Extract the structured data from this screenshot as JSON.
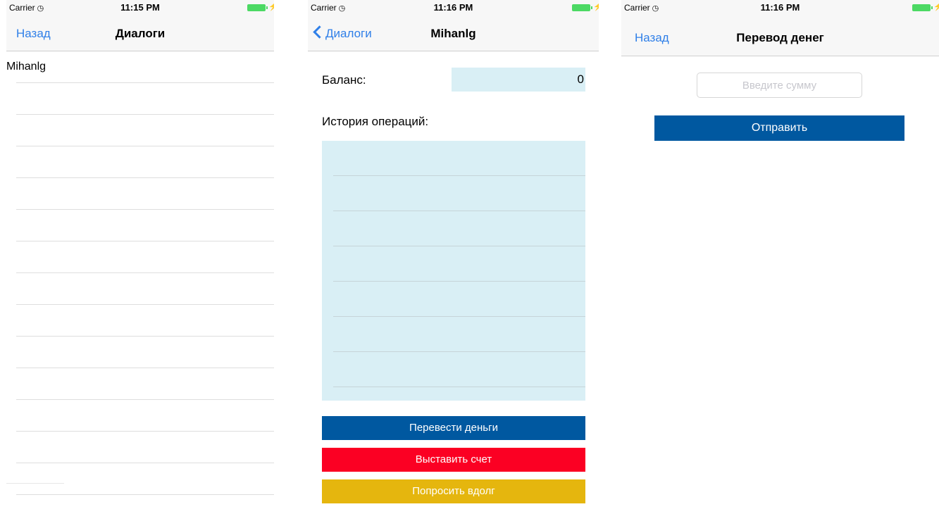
{
  "screens": [
    {
      "status": {
        "carrier": "Carrier",
        "wifi_icon": "wifi-icon",
        "time": "11:15 PM",
        "battery_color": "#4cd964"
      },
      "nav": {
        "back_label": "Назад",
        "title": "Диалоги"
      },
      "list": {
        "items": [
          "Mihanlg"
        ]
      }
    },
    {
      "status": {
        "carrier": "Carrier",
        "wifi_icon": "wifi-icon",
        "time": "11:16 PM",
        "battery_color": "#4cd964"
      },
      "nav": {
        "back_label": "Диалоги",
        "title": "Mihanlg"
      },
      "balance": {
        "label": "Баланс:",
        "value": "0"
      },
      "history": {
        "label": "История операций:"
      },
      "buttons": {
        "transfer": "Перевести деньги",
        "invoice": "Выставить счет",
        "borrow": "Попросить вдолг"
      },
      "colors": {
        "transfer": "#0058a0",
        "invoice": "#fb0023",
        "borrow": "#e5b60e",
        "field_bg": "#d9eff5"
      }
    },
    {
      "status": {
        "carrier": "Carrier",
        "wifi_icon": "wifi-icon",
        "time": "11:16 PM",
        "battery_color": "#4cd964"
      },
      "nav": {
        "back_label": "Назад",
        "title": "Перевод денег"
      },
      "amount": {
        "placeholder": "Введите сумму",
        "value": ""
      },
      "send_label": "Отправить"
    }
  ],
  "colors": {
    "accent": "#2f7fe8",
    "primary_button": "#0058a0"
  }
}
